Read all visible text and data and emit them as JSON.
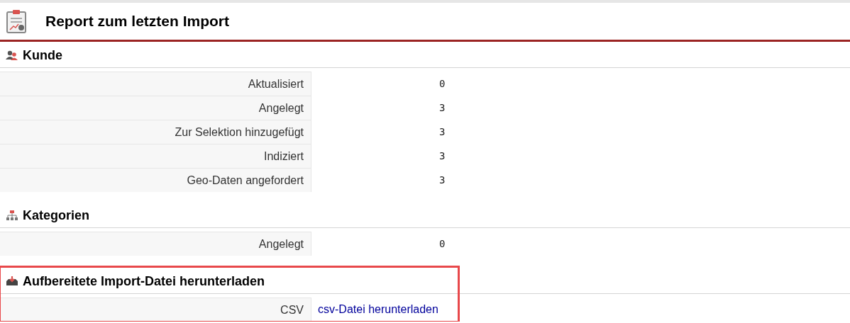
{
  "page_title": "Report zum letzten Import",
  "sections": [
    {
      "title": "Kunde",
      "kind": "users",
      "highlighted": false,
      "rows": [
        {
          "label": "Aktualisiert",
          "value": "0",
          "kind": "number"
        },
        {
          "label": "Angelegt",
          "value": "3",
          "kind": "number"
        },
        {
          "label": "Zur Selektion hinzugefügt",
          "value": "3",
          "kind": "number"
        },
        {
          "label": "Indiziert",
          "value": "3",
          "kind": "number"
        },
        {
          "label": "Geo-Daten angefordert",
          "value": "3",
          "kind": "number"
        }
      ]
    },
    {
      "title": "Kategorien",
      "kind": "hierarchy",
      "highlighted": false,
      "rows": [
        {
          "label": "Angelegt",
          "value": "0",
          "kind": "number"
        }
      ]
    },
    {
      "title": "Aufbereitete Import-Datei herunterladen",
      "kind": "download",
      "highlighted": true,
      "rows": [
        {
          "label": "CSV",
          "value": "csv-Datei herunterladen",
          "kind": "link"
        }
      ]
    }
  ]
}
